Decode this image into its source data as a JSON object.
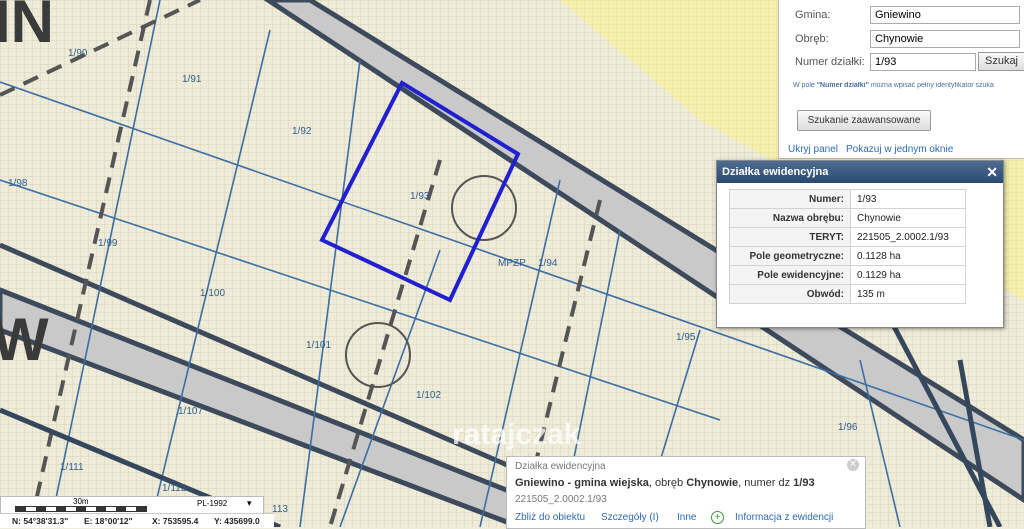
{
  "map": {
    "parcels": [
      "1/90",
      "1/91",
      "1/92",
      "1/93",
      "1/94",
      "1/95",
      "1/96",
      "1/98",
      "1/99",
      "1/100",
      "1/101",
      "1/102",
      "1/107",
      "1/111",
      "1/112",
      "113"
    ],
    "plan_label": "MPZP",
    "big_letters": [
      "IN",
      "W"
    ],
    "watermark": "ratajczak",
    "selected_color": "#2020d0"
  },
  "search": {
    "gmina_label": "Gmina:",
    "gmina_value": "Gniewino",
    "obreb_label": "Obręb:",
    "obreb_value": "Chynowie",
    "numer_label": "Numer działki:",
    "numer_value": "1/93",
    "search_btn": "Szukaj",
    "hint_prefix": "W pole ",
    "hint_bold": "\"Numer działki\"",
    "hint_suffix": " można wpisać pełny identyfikator szuka",
    "advanced_btn": "Szukanie zaawansowane",
    "hide_panel": "Ukryj panel",
    "show_one_window": "Pokazuj w jednym oknie"
  },
  "popup": {
    "title": "Działka ewidencyjna",
    "rows": [
      {
        "k": "Numer:",
        "v": "1/93"
      },
      {
        "k": "Nazwa obrębu:",
        "v": "Chynowie"
      },
      {
        "k": "TERYT:",
        "v": "221505_2.0002.1/93"
      },
      {
        "k": "Pole geometryczne:",
        "v": "0.1128 ha"
      },
      {
        "k": "Pole ewidencyjne:",
        "v": "0.1129 ha"
      },
      {
        "k": "Obwód:",
        "v": "135 m"
      }
    ]
  },
  "info": {
    "title": "Działka ewidencyjna",
    "gmina": "Gniewino - gmina wiejska",
    "obreb_prefix": ", obręb ",
    "obreb": "Chynowie",
    "numer_prefix": ", numer dz ",
    "numer": "1/93",
    "teryt": "221505_2.0002.1/93",
    "link_zoom": "Zbliż do obiektu",
    "link_details": "Szczegóły (I)",
    "link_other": "Inne",
    "link_info": "Informacja z ewidencji"
  },
  "scale": {
    "label": "30m",
    "crs": "PL-1992"
  },
  "coords": {
    "n": "N: 54°38'31.3\"",
    "e": "E: 18°00'12\"",
    "x": "X: 753595.4",
    "y": "Y: 435699.0"
  }
}
